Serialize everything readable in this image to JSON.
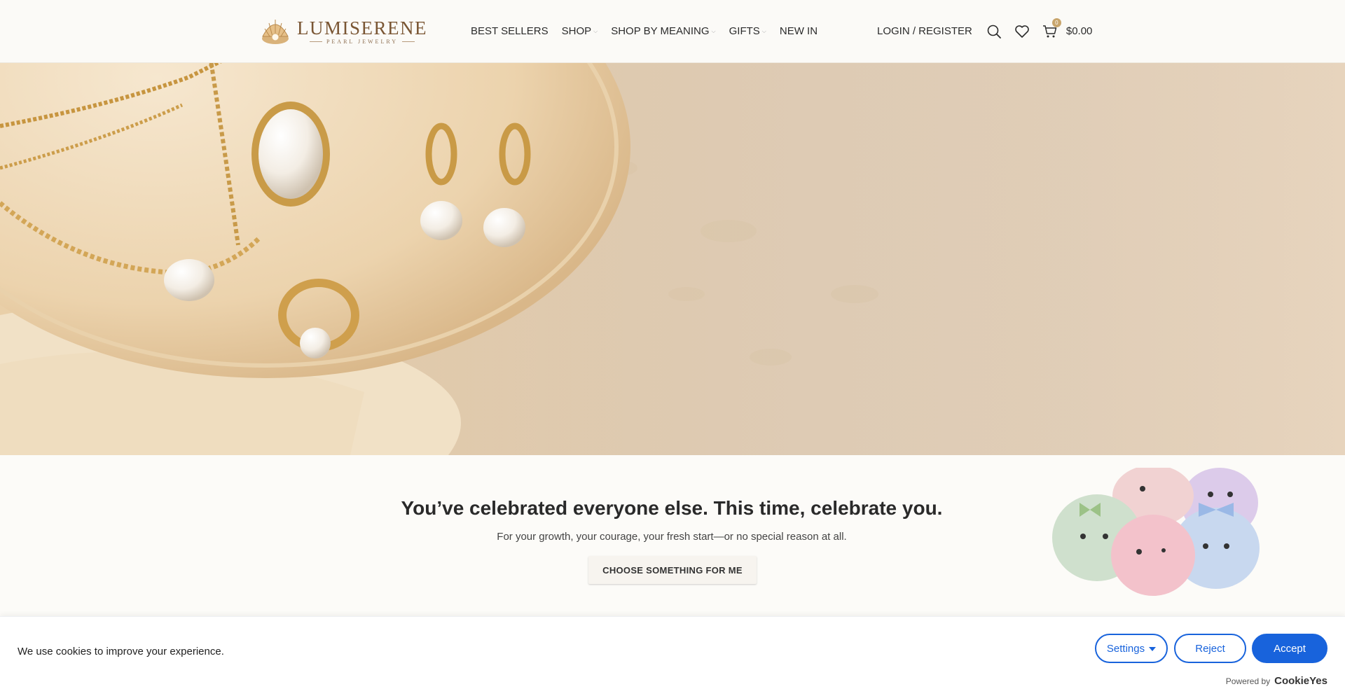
{
  "header": {
    "logo": {
      "name": "LUMISERENE",
      "tagline": "PEARL JEWELRY"
    },
    "nav": [
      {
        "label": "BEST SELLERS",
        "has_dropdown": false
      },
      {
        "label": "SHOP",
        "has_dropdown": true
      },
      {
        "label": "SHOP BY MEANING",
        "has_dropdown": true
      },
      {
        "label": "GIFTS",
        "has_dropdown": true
      },
      {
        "label": "NEW IN",
        "has_dropdown": false
      }
    ],
    "login_label": "LOGIN / REGISTER",
    "icons": [
      "search-icon",
      "heart-icon",
      "cart-icon"
    ],
    "cart": {
      "count": "0",
      "total": "$0.00"
    }
  },
  "intro": {
    "title": "You’ve celebrated everyone else. This time, celebrate you.",
    "subtitle": "For your growth, your courage, your fresh start—or no special reason at all.",
    "cta_label": "CHOOSE SOMETHING FOR ME"
  },
  "cookie_banner": {
    "message": "We use cookies to improve your experience.",
    "settings_label": "Settings",
    "reject_label": "Reject",
    "accept_label": "Accept",
    "powered_label": "Powered by",
    "powered_brand": "CookieYes"
  },
  "colors": {
    "accent_blue": "#1863dc",
    "logo_brown": "#7a5634",
    "gold": "#c8a56c"
  }
}
